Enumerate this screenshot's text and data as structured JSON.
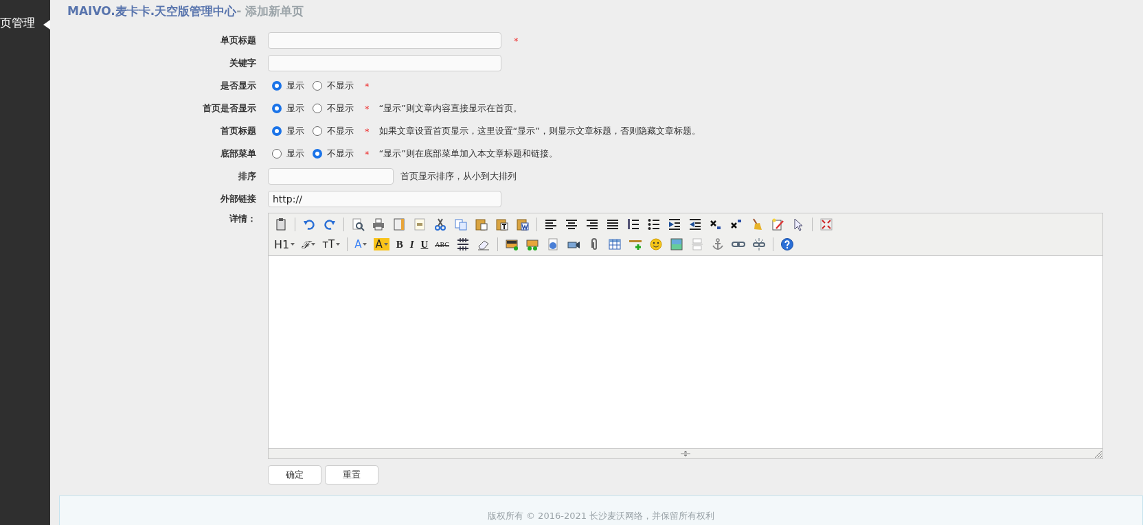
{
  "sidebar": {
    "item": "页管理"
  },
  "header": {
    "title": "MAIVO.麦卡卡.天空版管理中心",
    "subtitle": "- 添加新单页"
  },
  "fields": [
    {
      "kind": "text",
      "label": "单页标题",
      "required": "*"
    },
    {
      "kind": "text",
      "label": "关键字"
    },
    {
      "kind": "radio",
      "label": "是否显示",
      "required": "*",
      "options": [
        {
          "label": "显示",
          "selected": true
        },
        {
          "label": "不显示",
          "selected": false
        }
      ]
    },
    {
      "kind": "radio",
      "label": "首页是否显示",
      "required": "*",
      "note": "“显示”则文章内容直接显示在首页。",
      "options": [
        {
          "label": "显示",
          "selected": true
        },
        {
          "label": "不显示",
          "selected": false
        }
      ]
    },
    {
      "kind": "radio",
      "label": "首页标题",
      "required": "*",
      "note": "如果文章设置首页显示，这里设置“显示”，则显示文章标题，否则隐藏文章标题。",
      "options": [
        {
          "label": "显示",
          "selected": true
        },
        {
          "label": "不显示",
          "selected": false
        }
      ]
    },
    {
      "kind": "radio",
      "label": "底部菜单",
      "required": "*",
      "note": "“显示”则在底部菜单加入本文章标题和链接。",
      "options": [
        {
          "label": "显示",
          "selected": false
        },
        {
          "label": "不显示",
          "selected": true
        }
      ]
    },
    {
      "kind": "short",
      "label": "排序",
      "note": "首页显示排序，从小到大排列"
    },
    {
      "kind": "text",
      "label": "外部链接",
      "value": "http://"
    }
  ],
  "editor": {
    "label": "详情：",
    "toolbar": [
      [
        {
          "kind": "icon"
        },
        {
          "kind": "sep"
        },
        {
          "kind": "icon"
        },
        {
          "kind": "icon"
        },
        {
          "kind": "sep"
        },
        {
          "kind": "icon"
        },
        {
          "kind": "icon"
        },
        {
          "kind": "icon"
        },
        {
          "kind": "icon"
        },
        {
          "kind": "icon"
        },
        {
          "kind": "icon"
        },
        {
          "kind": "icon"
        },
        {
          "kind": "icon"
        },
        {
          "kind": "icon"
        },
        {
          "kind": "sep"
        },
        {
          "kind": "icon"
        },
        {
          "kind": "icon"
        },
        {
          "kind": "icon"
        },
        {
          "kind": "icon"
        },
        {
          "kind": "icon"
        },
        {
          "kind": "icon"
        },
        {
          "kind": "icon"
        },
        {
          "kind": "icon"
        },
        {
          "kind": "icon"
        },
        {
          "kind": "icon"
        },
        {
          "kind": "icon"
        },
        {
          "kind": "icon"
        },
        {
          "kind": "icon"
        },
        {
          "kind": "sep"
        },
        {
          "kind": "icon"
        }
      ],
      [
        {
          "kind": "text",
          "label": "H1"
        },
        {
          "kind": "text",
          "label": "ℱ"
        },
        {
          "kind": "text",
          "label": "ᴛT"
        },
        {
          "kind": "sep"
        },
        {
          "kind": "text",
          "label": "A"
        },
        {
          "kind": "text",
          "label": "A"
        },
        {
          "kind": "text",
          "label": "B"
        },
        {
          "kind": "text",
          "label": "I"
        },
        {
          "kind": "text",
          "label": "U"
        },
        {
          "kind": "text",
          "label": "ABC"
        },
        {
          "kind": "icon"
        },
        {
          "kind": "icon"
        },
        {
          "kind": "sep"
        },
        {
          "kind": "icon"
        },
        {
          "kind": "icon"
        },
        {
          "kind": "icon"
        },
        {
          "kind": "icon"
        },
        {
          "kind": "icon"
        },
        {
          "kind": "icon"
        },
        {
          "kind": "icon"
        },
        {
          "kind": "icon"
        },
        {
          "kind": "icon"
        },
        {
          "kind": "icon"
        },
        {
          "kind": "icon"
        },
        {
          "kind": "icon"
        },
        {
          "kind": "icon"
        },
        {
          "kind": "sep"
        },
        {
          "kind": "icon"
        }
      ]
    ]
  },
  "buttons": [
    "确定",
    "重置"
  ],
  "footer": "版权所有 © 2016-2021 长沙麦沃网络，并保留所有权利"
}
